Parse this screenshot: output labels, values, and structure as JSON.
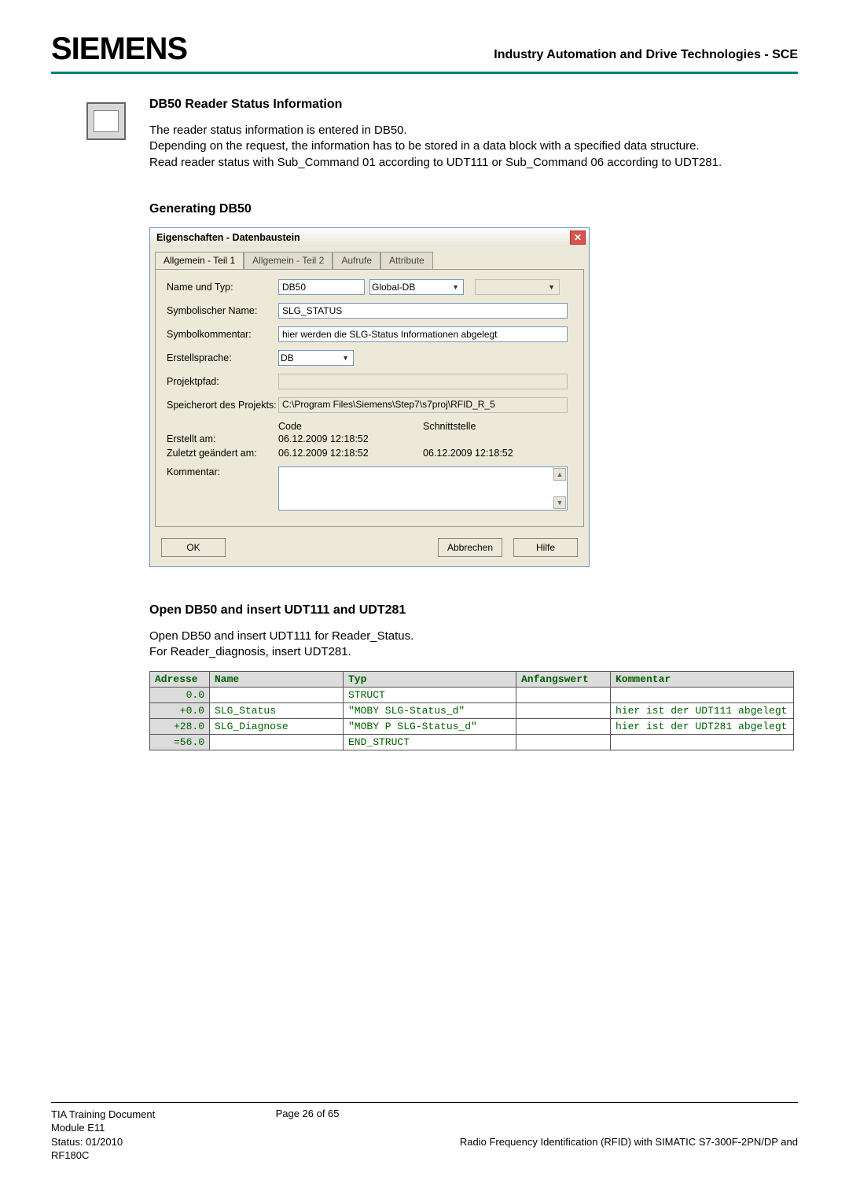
{
  "header": {
    "brand": "SIEMENS",
    "right": "Industry Automation and Drive Technologies - SCE"
  },
  "sec1": {
    "heading": "DB50 Reader Status Information",
    "p1": "The reader status information is entered in DB50.",
    "p2": "Depending on the request, the information has to be stored in a data block with a specified data structure.",
    "p3": "Read reader status with Sub_Command 01 according to UDT111 or Sub_Command 06 according to UDT281."
  },
  "sec2": {
    "heading": "Generating DB50"
  },
  "dialog": {
    "title": "Eigenschaften - Datenbaustein",
    "tabs": [
      "Allgemein - Teil 1",
      "Allgemein - Teil 2",
      "Aufrufe",
      "Attribute"
    ],
    "labels": {
      "nametype": "Name und Typ:",
      "symname": "Symbolischer Name:",
      "symcomment": "Symbolkommentar:",
      "lang": "Erstellsprache:",
      "projpath": "Projektpfad:",
      "projloc": "Speicherort des Projekts:",
      "code": "Code",
      "iface": "Schnittstelle",
      "created": "Erstellt am:",
      "modified": "Zuletzt geändert am:",
      "comment": "Kommentar:"
    },
    "values": {
      "name": "DB50",
      "dbtype": "Global-DB",
      "symname": "SLG_STATUS",
      "symcomment": "hier werden die SLG-Status Informationen abgelegt",
      "lang": "DB",
      "projpath": "",
      "projloc": "C:\\Program Files\\Siemens\\Step7\\s7proj\\RFID_R_5",
      "created_code": "06.12.2009 12:18:52",
      "modified_code": "06.12.2009 12:18:52",
      "modified_iface": "06.12.2009 12:18:52"
    },
    "buttons": {
      "ok": "OK",
      "cancel": "Abbrechen",
      "help": "Hilfe"
    }
  },
  "sec3": {
    "heading": "Open DB50 and insert UDT111 and UDT281",
    "p1": "Open DB50 and insert UDT111 for Reader_Status.",
    "p2": "For Reader_diagnosis, insert UDT281."
  },
  "table": {
    "headers": {
      "addr": "Adresse",
      "name": "Name",
      "type": "Typ",
      "init": "Anfangswert",
      "comment": "Kommentar"
    },
    "rows": [
      {
        "addr": "0.0",
        "name": "",
        "type": "STRUCT",
        "init": "",
        "comment": ""
      },
      {
        "addr": "+0.0",
        "name": "SLG_Status",
        "type": "\"MOBY SLG-Status_d\"",
        "init": "",
        "comment": "hier ist der UDT111 abgelegt"
      },
      {
        "addr": "+28.0",
        "name": "SLG_Diagnose",
        "type": "\"MOBY P SLG-Status_d\"",
        "init": "",
        "comment": "hier ist der UDT281 abgelegt"
      },
      {
        "addr": "=56.0",
        "name": "",
        "type": "END_STRUCT",
        "init": "",
        "comment": ""
      }
    ]
  },
  "footer": {
    "left1": "TIA Training Document",
    "left2": "Module E11",
    "left3": "Status: 01/2010",
    "left4": "RF180C",
    "center": "Page 26 of 65",
    "right": "Radio Frequency Identification (RFID) with SIMATIC S7-300F-2PN/DP and"
  }
}
